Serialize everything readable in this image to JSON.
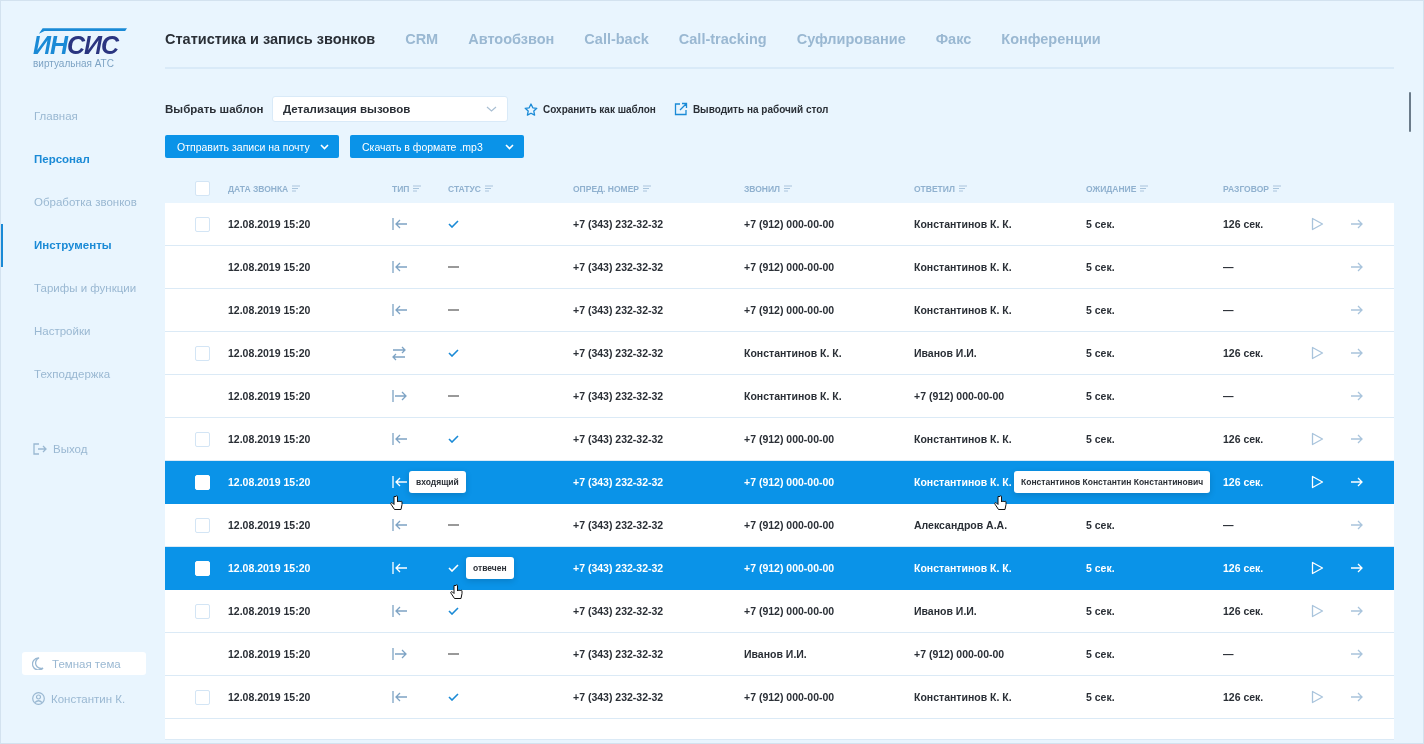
{
  "logo": {
    "left": "ИН",
    "right": "СИС",
    "tagline": "виртуальная АТС"
  },
  "top_tabs": [
    {
      "label": "Статистика и запись звонков",
      "selected": true
    },
    {
      "label": "CRM",
      "selected": false
    },
    {
      "label": "Автообзвон",
      "selected": false
    },
    {
      "label": "Call-back",
      "selected": false
    },
    {
      "label": "Call-tracking",
      "selected": false
    },
    {
      "label": "Суфлирование",
      "selected": false
    },
    {
      "label": "Факс",
      "selected": false
    },
    {
      "label": "Конференции",
      "selected": false
    }
  ],
  "sidebar": {
    "items": [
      {
        "label": "Главная",
        "selected": false,
        "hovered": false
      },
      {
        "label": "Персонал",
        "selected": false,
        "hovered": true
      },
      {
        "label": "Обработка звонков",
        "selected": false,
        "hovered": false
      },
      {
        "label": "Инструменты",
        "selected": true,
        "hovered": false
      },
      {
        "label": "Тарифы и функции",
        "selected": false,
        "hovered": false
      },
      {
        "label": "Настройки",
        "selected": false,
        "hovered": false
      },
      {
        "label": "Техподдержка",
        "selected": false,
        "hovered": false
      }
    ],
    "logout": "Выход",
    "theme_toggle": "Темная тема",
    "user": "Константин К."
  },
  "template": {
    "label": "Выбрать шаблон",
    "value": "Детализация вызовов",
    "save": "Сохранить как шаблон",
    "desktop": "Выводить на рабочий стол"
  },
  "actions": [
    "Отправить записи на почту",
    "Скачать в формате .mp3"
  ],
  "table": {
    "select_all": {
      "checked": false
    },
    "columns": [
      "ДАТА ЗВОНКА",
      "ТИП",
      "СТАТУС",
      "ОПРЕД. НОМЕР",
      "ЗВОНИЛ",
      "ОТВЕТИЛ",
      "ОЖИДАНИЕ",
      "РАЗГОВОР"
    ],
    "rows": [
      {
        "checked": false,
        "selected": false,
        "date": "12.08.2019  15:20",
        "direction": {
          "kind": "in"
        },
        "status": {
          "kind": "answered"
        },
        "number": "+7 (343) 232-32-32",
        "caller": "+7 (912) 000-00-00",
        "answerer": "Константинов К. К.",
        "wait": "5 сек.",
        "talk": "126 сек.",
        "play": true
      },
      {
        "selected": false,
        "date": "12.08.2019  15:20",
        "direction": {
          "kind": "in"
        },
        "status": {
          "kind": "missed"
        },
        "number": "+7 (343) 232-32-32",
        "caller": "+7 (912) 000-00-00",
        "answerer": "Константинов К. К.",
        "wait": "5 сек.",
        "talk": "—",
        "play": false
      },
      {
        "selected": false,
        "date": "12.08.2019  15:20",
        "direction": {
          "kind": "in"
        },
        "status": {
          "kind": "missed"
        },
        "number": "+7 (343) 232-32-32",
        "caller": "+7 (912) 000-00-00",
        "answerer": "Константинов К. К.",
        "wait": "5 сек.",
        "talk": "—",
        "play": false
      },
      {
        "checked": false,
        "selected": false,
        "date": "12.08.2019  15:20",
        "direction": {
          "kind": "transfer"
        },
        "status": {
          "kind": "answered"
        },
        "number": "+7 (343) 232-32-32",
        "caller": "Константинов К. К.",
        "answerer": "Иванов И.И.",
        "wait": "5 сек.",
        "talk": "126 сек.",
        "play": true
      },
      {
        "selected": false,
        "date": "12.08.2019  15:20",
        "direction": {
          "kind": "out"
        },
        "status": {
          "kind": "missed"
        },
        "number": "+7 (343) 232-32-32",
        "caller": "Константинов К. К.",
        "answerer": "+7 (912) 000-00-00",
        "wait": "5 сек.",
        "talk": "—",
        "play": false
      },
      {
        "checked": false,
        "selected": false,
        "date": "12.08.2019  15:20",
        "direction": {
          "kind": "in"
        },
        "status": {
          "kind": "answered"
        },
        "number": "+7 (343) 232-32-32",
        "caller": "+7 (912) 000-00-00",
        "answerer": "Константинов К. К.",
        "wait": "5 сек.",
        "talk": "126 сек.",
        "play": true
      },
      {
        "checked": false,
        "selected": true,
        "date": "12.08.2019  15:20",
        "direction": {
          "kind": "in",
          "tooltip": "входящий"
        },
        "number": "+7 (343) 232-32-32",
        "caller": "+7 (912) 000-00-00",
        "answerer": "Константинов К. К.",
        "answerer_tooltip": "Константинов Константин Константинович",
        "talk": "126 сек.",
        "play": true
      },
      {
        "checked": false,
        "selected": false,
        "date": "12.08.2019  15:20",
        "direction": {
          "kind": "in"
        },
        "status": {
          "kind": "missed"
        },
        "number": "+7 (343) 232-32-32",
        "caller": "+7 (912) 000-00-00",
        "answerer": "Александров А.А.",
        "wait": "5 сек.",
        "talk": "—",
        "play": false
      },
      {
        "checked": false,
        "selected": true,
        "date": "12.08.2019  15:20",
        "direction": {
          "kind": "in"
        },
        "status": {
          "kind": "answered",
          "tooltip": "отвечен"
        },
        "number": "+7 (343) 232-32-32",
        "caller": "+7 (912) 000-00-00",
        "answerer": "Константинов К. К.",
        "wait": "5 сек.",
        "talk": "126 сек.",
        "play": true
      },
      {
        "checked": false,
        "selected": false,
        "date": "12.08.2019  15:20",
        "direction": {
          "kind": "in"
        },
        "status": {
          "kind": "answered"
        },
        "number": "+7 (343) 232-32-32",
        "caller": "+7 (912) 000-00-00",
        "answerer": "Иванов И.И.",
        "wait": "5 сек.",
        "talk": "126 сек.",
        "play": true
      },
      {
        "selected": false,
        "date": "12.08.2019  15:20",
        "direction": {
          "kind": "out"
        },
        "status": {
          "kind": "missed"
        },
        "number": "+7 (343) 232-32-32",
        "caller": "Иванов И.И.",
        "answerer": "+7 (912) 000-00-00",
        "wait": "5 сек.",
        "talk": "—",
        "play": false
      },
      {
        "checked": false,
        "selected": false,
        "date": "12.08.2019  15:20",
        "direction": {
          "kind": "in"
        },
        "status": {
          "kind": "answered"
        },
        "number": "+7 (343) 232-32-32",
        "caller": "+7 (912) 000-00-00",
        "answerer": "Константинов К. К.",
        "wait": "5 сек.",
        "talk": "126 сек.",
        "play": true
      }
    ]
  }
}
